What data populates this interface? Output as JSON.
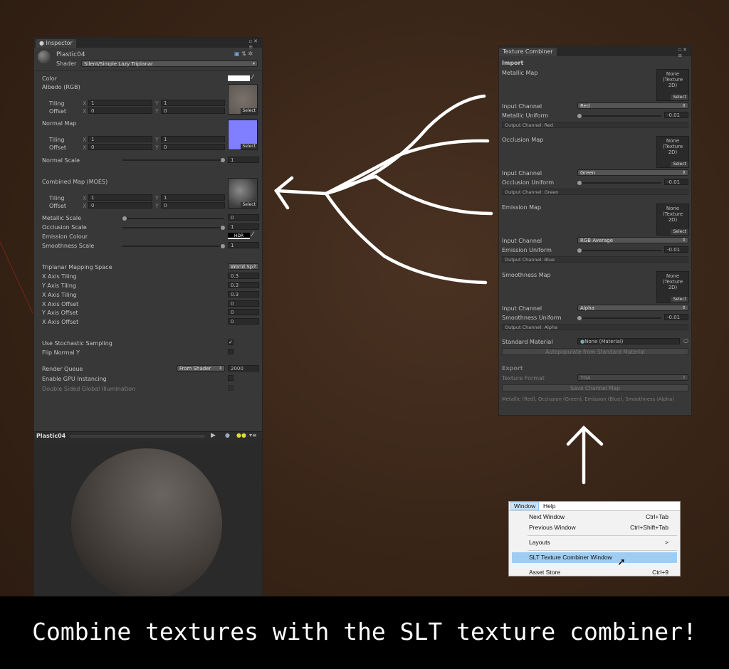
{
  "inspector": {
    "tab": "Inspector",
    "material_name": "Plastic04",
    "shader_label": "Shader",
    "shader_value": "Silent/Simple Lazy Triplanar",
    "color_label": "Color",
    "albedo_label": "Albedo (RGB)",
    "tiling_label": "Tiling",
    "offset_label": "Offset",
    "x": "X",
    "y": "Y",
    "albedo_tiling_x": "1",
    "albedo_tiling_y": "1",
    "albedo_offset_x": "0",
    "albedo_offset_y": "0",
    "normal_map_label": "Normal Map",
    "normal_tiling_x": "1",
    "normal_tiling_y": "1",
    "normal_offset_x": "0",
    "normal_offset_y": "0",
    "normal_scale_label": "Normal Scale",
    "normal_scale_value": "1",
    "combined_map_label": "Combined Map (MOES)",
    "combined_tiling_x": "1",
    "combined_tiling_y": "1",
    "combined_offset_x": "0",
    "combined_offset_y": "0",
    "select": "Select",
    "metallic_scale_label": "Metallic Scale",
    "metallic_scale_value": "0",
    "occlusion_scale_label": "Occlusion Scale",
    "occlusion_scale_value": "1",
    "emission_colour_label": "Emission Colour",
    "hdr": "HDR",
    "smoothness_scale_label": "Smoothness Scale",
    "smoothness_scale_value": "1",
    "triplanar_label": "Triplanar Mapping Space",
    "triplanar_value": "World Sp",
    "x_tiling_label": "X Axis Tiling",
    "x_tiling_value": "0.3",
    "y_tiling_label": "Y Axis Tiling",
    "y_tiling_value": "0.3",
    "x_tiling2_label": "X Axis Tiling",
    "x_tiling2_value": "0.3",
    "x_offset_label": "X Axis Offset",
    "x_offset_value": "0",
    "y_offset_label": "Y Axis Offset",
    "y_offset_value": "0",
    "x_offset2_label": "X Axis Offset",
    "x_offset2_value": "0",
    "stochastic_label": "Use Stochastic Sampling",
    "flip_normal_label": "Flip Normal Y",
    "render_queue_label": "Render Queue",
    "render_queue_mode": "From Shader",
    "render_queue_value": "2000",
    "gpu_instancing_label": "Enable GPU Instancing",
    "double_sided_label": "Double Sided Global Illumination",
    "preview_name": "Plastic04"
  },
  "combiner": {
    "tab": "Texture Combiner",
    "import_label": "Import",
    "none_text": "None",
    "texture_text": "(Texture",
    "twod_text": "2D)",
    "select": "Select",
    "input_channel_label": "Input Channel",
    "maps": [
      {
        "name": "Metallic Map",
        "channel": "Red",
        "uniform_label": "Metallic Uniform",
        "uniform_value": "-0.01",
        "output": "Output Channel: Red"
      },
      {
        "name": "Occlusion Map",
        "channel": "Green",
        "uniform_label": "Occlusion Uniform",
        "uniform_value": "-0.01",
        "output": "Output Channel: Green"
      },
      {
        "name": "Emission Map",
        "channel": "RGB Average",
        "uniform_label": "Emission Uniform",
        "uniform_value": "-0.01",
        "output": "Output Channel: Blue"
      },
      {
        "name": "Smoothness Map",
        "channel": "Alpha",
        "uniform_label": "Smoothness Uniform",
        "uniform_value": "-0.01",
        "output": "Output Channel: Alpha"
      }
    ],
    "standard_material_label": "Standard Material",
    "standard_material_value": "None (Material)",
    "autopopulate": "Autopopulate from Standard Material",
    "export_label": "Export",
    "texture_format_label": "Texture Format",
    "texture_format_value": "TGA",
    "save_button": "Save Channel Map",
    "footer": "Metallic (Red), Occlusion (Green), Emission (Blue), Smoothness (Alpha)"
  },
  "menu": {
    "bar": [
      "Window",
      "Help"
    ],
    "items": [
      {
        "label": "Next Window",
        "shortcut": "Ctrl+Tab"
      },
      {
        "label": "Previous Window",
        "shortcut": "Ctrl+Shift+Tab"
      },
      {
        "label": "Layouts",
        "shortcut": ">"
      },
      {
        "label": "SLT Texture Combiner Window",
        "shortcut": ""
      },
      {
        "label": "Asset Store",
        "shortcut": "Ctrl+9"
      }
    ]
  },
  "caption": "Combine textures with the SLT texture combiner!",
  "colors": {
    "accent_highlight": "#9fcdf2",
    "normal_map": "#7f7fff",
    "background": "#3a2618"
  }
}
